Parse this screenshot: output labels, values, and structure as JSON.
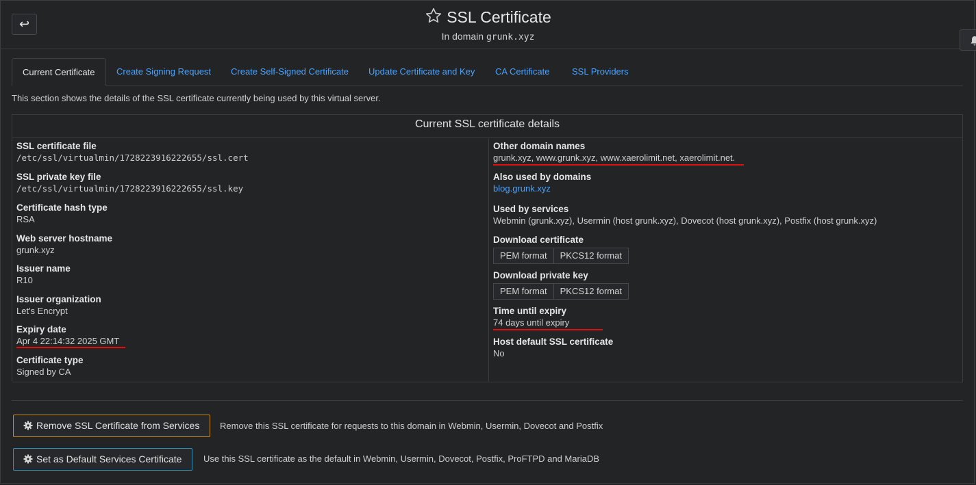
{
  "header": {
    "back_icon": "undo-arrow-icon",
    "star_icon": "star-outline-icon",
    "title": "SSL Certificate",
    "subtitle_prefix": "In domain",
    "subtitle_domain": "grunk.xyz",
    "bell_icon": "bell-icon"
  },
  "tabs": [
    {
      "label": "Current Certificate",
      "active": true
    },
    {
      "label": "Create Signing Request",
      "active": false
    },
    {
      "label": "Create Self-Signed Certificate",
      "active": false
    },
    {
      "label": "Update Certificate and Key",
      "active": false
    },
    {
      "label": "CA Certificate",
      "active": false
    },
    {
      "label": "SSL Providers",
      "active": false
    }
  ],
  "intro": "This section shows the details of the SSL certificate currently being used by this virtual server.",
  "panel": {
    "title": "Current SSL certificate details",
    "left": [
      {
        "label": "SSL certificate file",
        "value": "/etc/ssl/virtualmin/1728223916222655/ssl.cert"
      },
      {
        "label": "SSL private key file",
        "value": "/etc/ssl/virtualmin/1728223916222655/ssl.key"
      },
      {
        "label": "Certificate hash type",
        "value": "RSA"
      },
      {
        "label": "Web server hostname",
        "value": "grunk.xyz"
      },
      {
        "label": "Issuer name",
        "value": "R10"
      },
      {
        "label": "Issuer organization",
        "value": "Let's Encrypt"
      },
      {
        "label": "Expiry date",
        "value": "Apr 4 22:14:32 2025 GMT"
      },
      {
        "label": "Certificate type",
        "value": "Signed by CA"
      }
    ],
    "right": {
      "other_domains": {
        "label": "Other domain names",
        "value": "grunk.xyz, www.grunk.xyz, www.xaerolimit.net, xaerolimit.net."
      },
      "also_used": {
        "label": "Also used by domains",
        "value": "blog.grunk.xyz"
      },
      "services": {
        "label": "Used by services",
        "value": "Webmin (grunk.xyz), Usermin (host grunk.xyz), Dovecot (host grunk.xyz), Postfix (host grunk.xyz)"
      },
      "download_cert": {
        "label": "Download certificate",
        "pem": "PEM format",
        "pkcs": "PKCS12 format"
      },
      "download_key": {
        "label": "Download private key",
        "pem": "PEM format",
        "pkcs": "PKCS12 format"
      },
      "expiry": {
        "label": "Time until expiry",
        "value": "74 days until expiry"
      },
      "host_default": {
        "label": "Host default SSL certificate",
        "value": "No"
      }
    }
  },
  "actions": {
    "remove": {
      "label": "Remove SSL Certificate from Services",
      "desc": "Remove this SSL certificate for requests to this domain in Webmin, Usermin, Dovecot and Postfix",
      "icon": "gear-icon"
    },
    "set_default": {
      "label": "Set as Default Services Certificate",
      "desc": "Use this SSL certificate as the default in Webmin, Usermin, Dovecot, Postfix, ProFTPD and MariaDB",
      "icon": "gear-icon"
    }
  },
  "colors": {
    "background": "#222426",
    "link": "#4aa3ff",
    "highlight_underline": "#e01010",
    "warning_border": "#c98d1f",
    "info_border": "#2f8fb4"
  }
}
